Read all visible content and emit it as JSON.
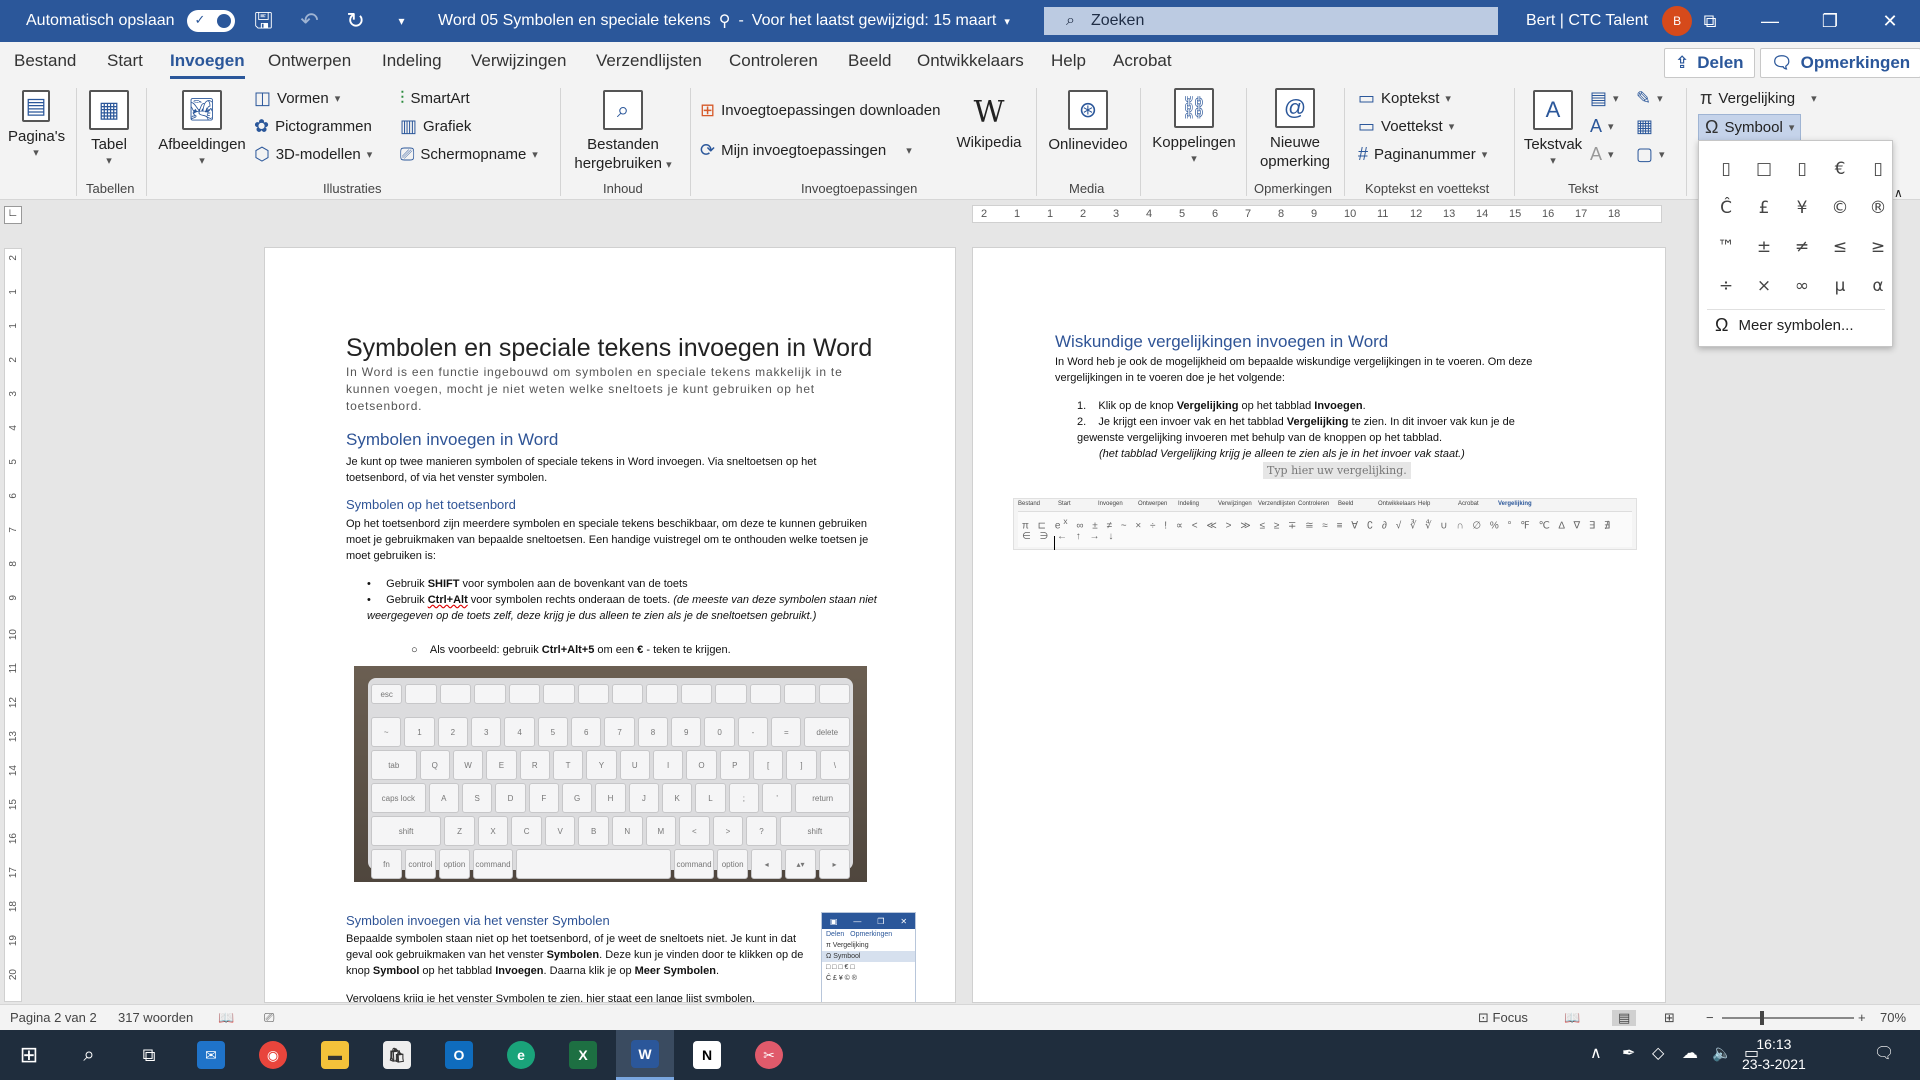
{
  "titlebar": {
    "autosave_label": "Automatisch opslaan",
    "autosave_state": "Aan",
    "doc_title": "Word 05 Symbolen en speciale tekens",
    "last_modified": "Voor het laatst gewijzigd: 15 maart",
    "search_placeholder": "Zoeken",
    "user_name": "Bert | CTC Talent",
    "avatar_initial": "B"
  },
  "tabs": [
    "Bestand",
    "Start",
    "Invoegen",
    "Ontwerpen",
    "Indeling",
    "Verwijzingen",
    "Verzendlijsten",
    "Controleren",
    "Beeld",
    "Ontwikkelaars",
    "Help",
    "Acrobat"
  ],
  "active_tab": "Invoegen",
  "share_label": "Delen",
  "comments_label": "Opmerkingen",
  "ribbon": {
    "pages": "Pagina's",
    "table": "Tabel",
    "pictures": "Afbeeldingen",
    "shapes": "Vormen",
    "icons": "Pictogrammen",
    "models3d": "3D-modellen",
    "smartart": "SmartArt",
    "chart": "Grafiek",
    "screenshot": "Schermopname",
    "reuse_files_1": "Bestanden",
    "reuse_files_2": "hergebruiken",
    "get_addins": "Invoegtoepassingen downloaden",
    "my_addins": "Mijn invoegtoepassingen",
    "wikipedia": "Wikipedia",
    "online_video": "Onlinevideo",
    "links": "Koppelingen",
    "new_comment_1": "Nieuwe",
    "new_comment_2": "opmerking",
    "header": "Koptekst",
    "footer": "Voettekst",
    "page_number": "Paginanummer",
    "textbox": "Tekstvak",
    "equation": "Vergelijking",
    "symbol": "Symbool",
    "groups": {
      "tables": "Tabellen",
      "illustrations": "Illustraties",
      "content": "Inhoud",
      "addins": "Invoegtoepassingen",
      "media": "Media",
      "comments": "Opmerkingen",
      "header_footer": "Koptekst en voettekst",
      "text": "Tekst"
    }
  },
  "symbol_dropdown": {
    "symbols": [
      "▯",
      "□",
      "▯",
      "€",
      "▯",
      "Ĉ",
      "£",
      "¥",
      "©",
      "®",
      "™",
      "±",
      "≠",
      "≤",
      "≥",
      "÷",
      "×",
      "∞",
      "µ",
      "α"
    ],
    "more_label": "Meer symbolen..."
  },
  "ruler": {
    "h_ticks": [
      "2",
      "1",
      "1",
      "2",
      "3",
      "4",
      "5",
      "6",
      "7",
      "8",
      "9",
      "10",
      "11",
      "12",
      "13",
      "14",
      "15",
      "16",
      "17",
      "18"
    ],
    "v_ticks": [
      "2",
      "1",
      "1",
      "2",
      "3",
      "4",
      "5",
      "6",
      "7",
      "8",
      "9",
      "10",
      "11",
      "12",
      "13",
      "14",
      "15",
      "16",
      "17",
      "18",
      "19",
      "20"
    ]
  },
  "page1": {
    "title": "Symbolen en speciale tekens invoegen in Word",
    "subtitle": "In Word is een functie ingebouwd om symbolen en speciale tekens makkelijk in te kunnen voegen, mocht je niet weten welke sneltoets je kunt gebruiken op het toetsenbord.",
    "h2": "Symbolen invoegen in Word",
    "intro": "Je kunt op twee manieren symbolen of speciale tekens in Word invoegen. Via sneltoetsen op het toetsenbord, of via het venster symbolen.",
    "h3a": "Symbolen op het toetsenbord",
    "para_a": "Op het toetsenbord zijn meerdere symbolen en speciale tekens beschikbaar, om deze te kunnen gebruiken moet je gebruikmaken van bepaalde sneltoetsen. Een handige vuistregel om te onthouden welke toetsen je moet gebruiken is:",
    "bullet1_pre": "Gebruik ",
    "bullet1_b": "SHIFT",
    "bullet1_post": " voor symbolen aan de bovenkant van de toets",
    "bullet2_pre": "Gebruik ",
    "bullet2_b": "Ctrl+Alt",
    "bullet2_post": " voor symbolen rechts onderaan de toets. ",
    "bullet2_i": "(de meeste van deze symbolen staan niet weergegeven op de toets zelf, deze krijg je dus alleen te zien als je de sneltoetsen gebruikt.)",
    "sub_pre": "Als voorbeeld: gebruik ",
    "sub_b": "Ctrl+Alt+5",
    "sub_mid": " om een ",
    "sub_b2": "€",
    "sub_post": " - teken te krijgen.",
    "h3b": "Symbolen invoegen via het venster Symbolen",
    "para_b1": "Bepaalde symbolen staan niet op het toetsenbord, of je weet de sneltoets niet. Je kunt in dat geval ook gebruikmaken van het venster ",
    "para_b1_b": "Symbolen",
    "para_b2": ". Deze kun je vinden door te klikken op de knop ",
    "para_b2_b": "Symbool",
    "para_b3": " op het tabblad ",
    "para_b3_b": "Invoegen",
    "para_b4": ". Daarna klik je op ",
    "para_b4_b": "Meer Symbolen",
    "para_b5": ".",
    "para_c": "Vervolgens krijg je het venster Symbolen te zien, hier staat een lange lijst symbolen."
  },
  "keyboard": {
    "rows": [
      [
        "esc",
        "",
        "",
        "",
        "",
        "",
        "",
        "",
        "",
        "",
        "",
        "",
        "",
        ""
      ],
      [
        "~",
        "1",
        "2",
        "3",
        "4",
        "5",
        "6",
        "7",
        "8",
        "9",
        "0",
        "-",
        "=",
        "delete"
      ],
      [
        "tab",
        "Q",
        "W",
        "E",
        "R",
        "T",
        "Y",
        "U",
        "I",
        "O",
        "P",
        "[",
        "]",
        "\\"
      ],
      [
        "caps lock",
        "A",
        "S",
        "D",
        "F",
        "G",
        "H",
        "J",
        "K",
        "L",
        ";",
        "'",
        "return"
      ],
      [
        "shift",
        "Z",
        "X",
        "C",
        "V",
        "B",
        "N",
        "M",
        "<",
        ">",
        "?",
        "shift"
      ],
      [
        "fn",
        "control",
        "option",
        "command",
        "",
        "command",
        "option",
        "◂",
        "▴▾",
        "▸"
      ]
    ]
  },
  "mini_shot": {
    "share": "Delen",
    "comments": "Opmerkingen",
    "equation": "Vergelijking",
    "symbol": "Symbool"
  },
  "page2": {
    "h2": "Wiskundige vergelijkingen invoegen in Word",
    "intro": "In Word heb je ook de mogelijkheid om bepaalde wiskundige vergelijkingen in te voeren. Om deze vergelijkingen in te voeren doe je het volgende:",
    "item1_pre": "Klik op de knop ",
    "item1_b": "Vergelijking",
    "item1_mid": " op het tabblad ",
    "item1_b2": "Invoegen",
    "item1_post": ".",
    "item2_pre": "Je krijgt een invoer vak en het tabblad ",
    "item2_b": "Vergelijking",
    "item2_post": " te zien. In dit invoer vak kun je de gewenste vergelijking invoeren met behulp van de knoppen op het tabblad.",
    "item2_note": "(het tabblad Vergelijking krijg je alleen te zien als je in het invoer vak staat.)",
    "eq_placeholder": "Typ hier uw vergelijking.",
    "eq_tabs": [
      "Bestand",
      "Start",
      "Invoegen",
      "Ontwerpen",
      "Indeling",
      "Verwijzingen",
      "Verzendlijsten",
      "Controleren",
      "Beeld",
      "Ontwikkelaars",
      "Help",
      "Acrobat",
      "Vergelijking"
    ]
  },
  "statusbar": {
    "page": "Pagina 2 van 2",
    "words": "317 woorden",
    "focus": "Focus",
    "zoom": "70%"
  },
  "taskbar": {
    "time": "16:13",
    "date": "23-3-2021"
  }
}
